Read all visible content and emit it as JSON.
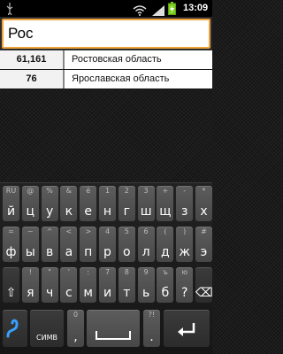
{
  "status_bar": {
    "time": "13:09",
    "icons": [
      "usb-icon",
      "wifi-icon",
      "signal-icon",
      "battery-charging-icon"
    ]
  },
  "search": {
    "value": "Рос"
  },
  "results": [
    {
      "number": "61,161",
      "name": "Ростовская область"
    },
    {
      "number": "76",
      "name": "Ярославская область"
    }
  ],
  "keyboard": {
    "row1": [
      {
        "hint": "RU",
        "key": "й"
      },
      {
        "hint": "@",
        "key": "ц"
      },
      {
        "hint": "%",
        "key": "у"
      },
      {
        "hint": "&",
        "key": "к"
      },
      {
        "hint": "ё",
        "key": "е"
      },
      {
        "hint": "1",
        "key": "н"
      },
      {
        "hint": "2",
        "key": "г"
      },
      {
        "hint": "3",
        "key": "ш"
      },
      {
        "hint": "+",
        "key": "щ"
      },
      {
        "hint": "-",
        "key": "з"
      },
      {
        "hint": "*",
        "key": "х"
      }
    ],
    "row2": [
      {
        "hint": "=",
        "key": "ф"
      },
      {
        "hint": "~",
        "key": "ы"
      },
      {
        "hint": "^",
        "key": "в"
      },
      {
        "hint": "<",
        "key": "а"
      },
      {
        "hint": ">",
        "key": "п"
      },
      {
        "hint": "4",
        "key": "р"
      },
      {
        "hint": "5",
        "key": "о"
      },
      {
        "hint": "6",
        "key": "л"
      },
      {
        "hint": "(",
        "key": "д"
      },
      {
        "hint": ")",
        "key": "ж"
      },
      {
        "hint": "#",
        "key": "э"
      }
    ],
    "row3": [
      {
        "hint": "",
        "key": "⇧"
      },
      {
        "hint": "!",
        "key": "я"
      },
      {
        "hint": "\"",
        "key": "ч"
      },
      {
        "hint": "'",
        "key": "с"
      },
      {
        "hint": ":",
        "key": "м"
      },
      {
        "hint": "7",
        "key": "и"
      },
      {
        "hint": "8",
        "key": "т"
      },
      {
        "hint": "9",
        "key": "ь"
      },
      {
        "hint": "ъ",
        "key": "б"
      },
      {
        "hint": "ю",
        "key": "?"
      },
      {
        "hint": "",
        "key": "⌫"
      }
    ],
    "row4": {
      "symbols_label": "СИМВ",
      "comma": ",",
      "comma_hint": "0",
      "period": ".",
      "period_hint": "?!"
    }
  }
}
